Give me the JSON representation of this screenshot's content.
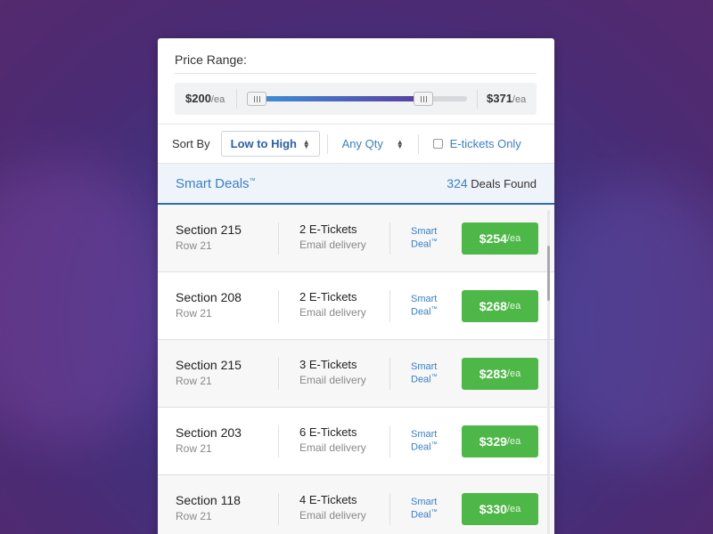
{
  "price_range": {
    "title": "Price Range:",
    "min_value": "$200",
    "max_value": "$371",
    "unit": "/ea",
    "slider_low_fraction": 0.0,
    "slider_high_fraction": 0.82
  },
  "filters": {
    "sort_label": "Sort By",
    "sort_value": "Low to High",
    "qty_value": "Any Qty",
    "etickets_label": "E-tickets Only",
    "etickets_checked": false
  },
  "deals": {
    "title": "Smart Deals",
    "trademark": "™",
    "count": "324",
    "count_label": "Deals Found"
  },
  "listings": [
    {
      "section": "Section 215",
      "row": "Row 21",
      "tickets": "2 E-Tickets",
      "delivery": "Email delivery",
      "smart1": "Smart",
      "smart2": "Deal",
      "tm": "™",
      "price": "$254",
      "unit": "/ea"
    },
    {
      "section": "Section 208",
      "row": "Row 21",
      "tickets": "2 E-Tickets",
      "delivery": "Email delivery",
      "smart1": "Smart",
      "smart2": "Deal",
      "tm": "™",
      "price": "$268",
      "unit": "/ea"
    },
    {
      "section": "Section 215",
      "row": "Row 21",
      "tickets": "3 E-Tickets",
      "delivery": "Email delivery",
      "smart1": "Smart",
      "smart2": "Deal",
      "tm": "™",
      "price": "$283",
      "unit": "/ea"
    },
    {
      "section": "Section 203",
      "row": "Row 21",
      "tickets": "6 E-Tickets",
      "delivery": "Email delivery",
      "smart1": "Smart",
      "smart2": "Deal",
      "tm": "™",
      "price": "$329",
      "unit": "/ea"
    },
    {
      "section": "Section 118",
      "row": "Row 21",
      "tickets": "4 E-Tickets",
      "delivery": "Email delivery",
      "smart1": "Smart",
      "smart2": "Deal",
      "tm": "™",
      "price": "$330",
      "unit": "/ea"
    }
  ],
  "colors": {
    "accent_blue": "#3a7fcb",
    "price_green": "#4db848",
    "background_purple": "#4a3a8a"
  }
}
